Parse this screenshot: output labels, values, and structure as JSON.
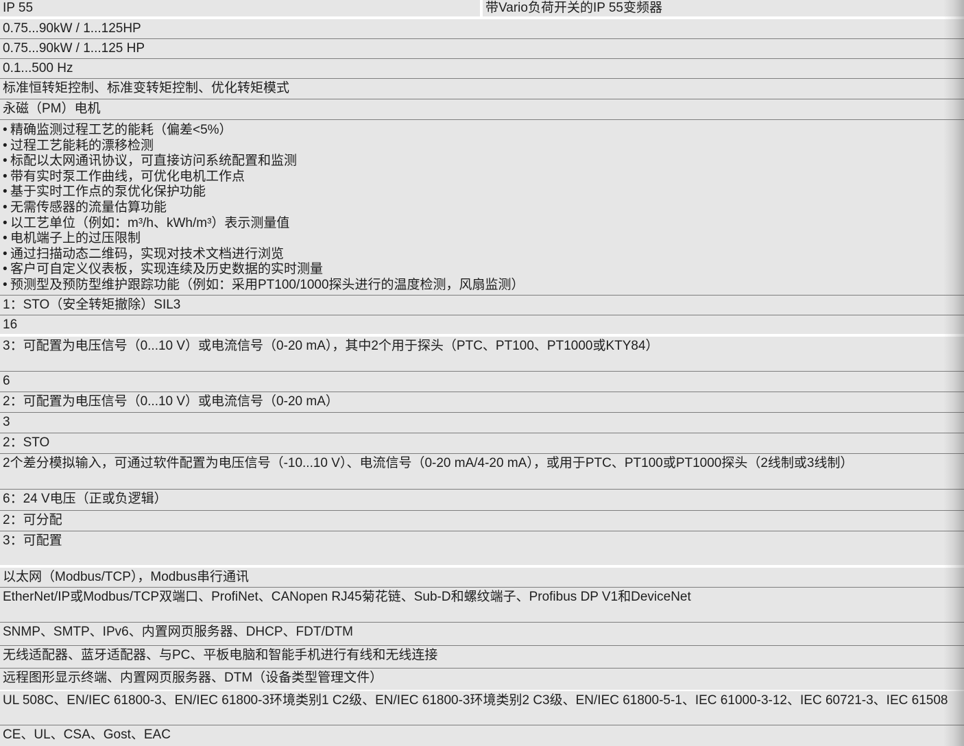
{
  "spec_table": {
    "rows": [
      {
        "cells": [
          "IP 55",
          "带Vario负荷开关的IP 55变频器"
        ]
      },
      {
        "cells": [
          "0.75...90kW / 1...125HP"
        ]
      },
      {
        "cells": [
          "0.75...90kW / 1...125 HP"
        ]
      },
      {
        "cells": [
          "0.1...500 Hz"
        ]
      },
      {
        "cells": [
          "标准恒转矩控制、标准变转矩控制、优化转矩模式"
        ]
      },
      {
        "cells": [
          "永磁（PM）电机"
        ]
      },
      {
        "items": [
          "精确监测过程工艺的能耗（偏差<5%）",
          "过程工艺能耗的漂移检测",
          "标配以太网通讯协议，可直接访问系统配置和监测",
          "带有实时泵工作曲线，可优化电机工作点",
          "基于实时工作点的泵优化保护功能",
          "无需传感器的流量估算功能",
          "以工艺单位（例如：m³/h、kWh/m³）表示测量值",
          "电机端子上的过压限制",
          "通过扫描动态二维码，实现对技术文档进行浏览",
          "客户可自定义仪表板，实现连续及历史数据的实时测量",
          "预测型及预防型维护跟踪功能（例如：采用PT100/1000探头进行的温度检测，风扇监测）"
        ]
      },
      {
        "cells": [
          "1：STO（安全转矩撤除）SIL3"
        ]
      },
      {
        "cells": [
          "16"
        ]
      },
      {
        "cells": [
          "3：可配置为电压信号（0...10 V）或电流信号（0-20 mA），其中2个用于探头（PTC、PT100、PT1000或KTY84）"
        ]
      },
      {
        "cells": [
          "6"
        ]
      },
      {
        "cells": [
          "2：可配置为电压信号（0...10 V）或电流信号（0-20 mA）"
        ]
      },
      {
        "cells": [
          "3"
        ]
      },
      {
        "cells": [
          "2：STO"
        ]
      },
      {
        "cells": [
          "2个差分模拟输入，可通过软件配置为电压信号（-10...10 V）、电流信号（0-20 mA/4-20 mA），或用于PTC、PT100或PT1000探头（2线制或3线制）"
        ]
      },
      {
        "cells": [
          "6：24 V电压（正或负逻辑）"
        ]
      },
      {
        "cells": [
          "2：可分配"
        ]
      },
      {
        "cells": [
          "3：可配置"
        ]
      },
      {
        "cells": [
          "以太网（Modbus/TCP），Modbus串行通讯"
        ]
      },
      {
        "cells": [
          "EtherNet/IP或Modbus/TCP双端口、ProfiNet、CANopen RJ45菊花链、Sub-D和螺纹端子、Profibus DP V1和DeviceNet"
        ]
      },
      {
        "cells": [
          "SNMP、SMTP、IPv6、内置网页服务器、DHCP、FDT/DTM"
        ]
      },
      {
        "cells": [
          "无线适配器、蓝牙适配器、与PC、平板电脑和智能手机进行有线和无线连接"
        ]
      },
      {
        "cells": [
          "远程图形显示终端、内置网页服务器、DTM（设备类型管理文件）"
        ]
      },
      {
        "cells": [
          "UL 508C、EN/IEC 61800-3、EN/IEC 61800-3环境类别1 C2级、EN/IEC 61800-3环境类别2 C3级、EN/IEC 61800-5-1、IEC 61000-3-12、IEC 60721-3、IEC 61508"
        ]
      },
      {
        "cells": [
          "CE、UL、CSA、Gost、EAC"
        ]
      }
    ]
  },
  "colors": {
    "row_bg": "#e6e6e6",
    "divider": "#7d7d7d",
    "text": "#1e1e1e",
    "gap": "#ffffff"
  }
}
